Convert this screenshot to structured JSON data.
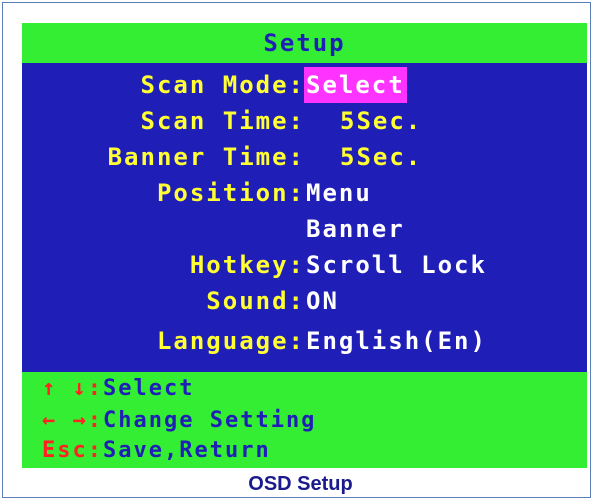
{
  "osd": {
    "title": "Setup",
    "settings": [
      {
        "label": "Scan Mode:",
        "value": "Select"
      },
      {
        "label": "Scan Time:",
        "value": "5Sec."
      },
      {
        "label": "Banner Time:",
        "value": "5Sec."
      },
      {
        "label": "Position:",
        "value": "Menu"
      },
      {
        "label": "",
        "value": "Banner"
      },
      {
        "label": "Hotkey:",
        "value": "Scroll Lock"
      },
      {
        "label": "Sound:",
        "value": "ON"
      },
      {
        "label": "Language:",
        "value": "English(En)"
      }
    ],
    "help": [
      {
        "key": "↑ ↓",
        "sep": ":",
        "text": "Select"
      },
      {
        "key": "← →",
        "sep": ":",
        "text": "Change Setting"
      },
      {
        "key": "Esc",
        "sep": ":",
        "text": "Save,Return"
      }
    ]
  },
  "caption": "OSD Setup",
  "colors": {
    "background_blue": "#1f1fb8",
    "bar_green": "#33ee33",
    "label_yellow": "#ffff33",
    "highlight_magenta": "#ff33ff",
    "key_red": "#ff2222"
  }
}
